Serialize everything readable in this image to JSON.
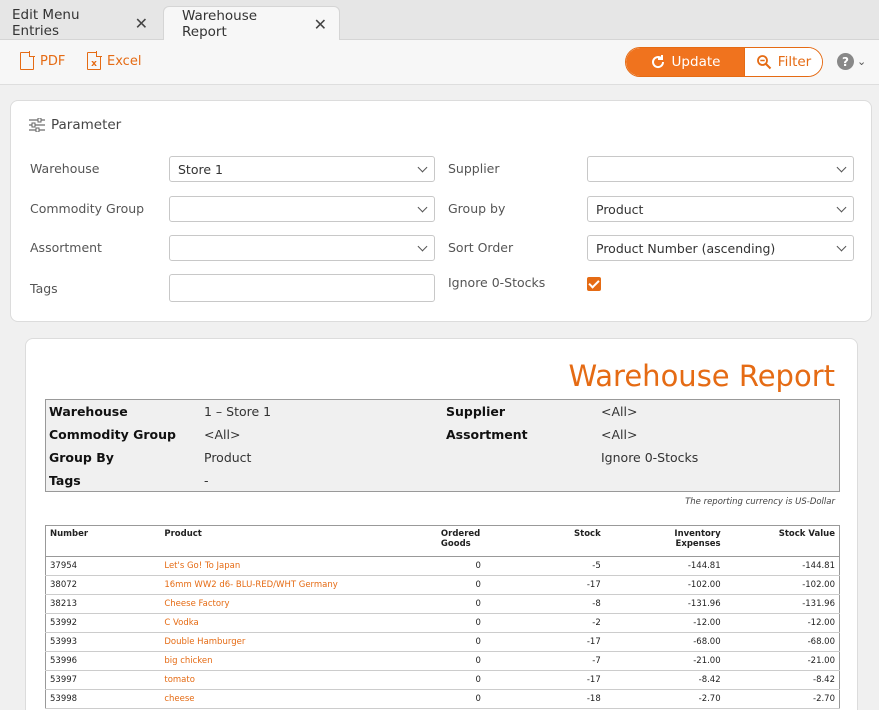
{
  "tabs": [
    {
      "label": "Edit Menu Entries",
      "active": false
    },
    {
      "label": "Warehouse Report",
      "active": true
    }
  ],
  "toolbar": {
    "pdf_label": "PDF",
    "excel_label": "Excel",
    "update_label": "Update",
    "filter_label": "Filter",
    "help_glyph": "?",
    "accent_color": "#e56b14"
  },
  "parameter": {
    "title": "Parameter",
    "fields": {
      "warehouse": {
        "label": "Warehouse",
        "value": "Store 1"
      },
      "supplier": {
        "label": "Supplier",
        "value": ""
      },
      "commodity_group": {
        "label": "Commodity Group",
        "value": ""
      },
      "group_by": {
        "label": "Group by",
        "value": "Product"
      },
      "assortment": {
        "label": "Assortment",
        "value": ""
      },
      "sort_order": {
        "label": "Sort Order",
        "value": "Product Number (ascending)"
      },
      "tags": {
        "label": "Tags",
        "value": ""
      },
      "ignore_zero": {
        "label": "Ignore 0-Stocks",
        "checked": true
      }
    }
  },
  "report": {
    "title": "Warehouse Report",
    "summary": {
      "warehouse_label": "Warehouse",
      "warehouse_value": "1 – Store 1",
      "supplier_label": "Supplier",
      "supplier_value": "<All>",
      "commodity_label": "Commodity Group",
      "commodity_value": "<All>",
      "assortment_label": "Assortment",
      "assortment_value": "<All>",
      "groupby_label": "Group By",
      "groupby_value": "Product",
      "ignore_value": "Ignore 0-Stocks",
      "tags_label": "Tags",
      "tags_value": "-"
    },
    "currency_note": "The reporting currency is US-Dollar",
    "columns": [
      "Number",
      "Product",
      "Ordered Goods",
      "Stock",
      "Inventory Expenses",
      "Stock Value"
    ],
    "rows": [
      {
        "number": "37954",
        "product": "Let's Go! To Japan",
        "ordered": "0",
        "stock": "-5",
        "expenses": "-144.81",
        "value": "-144.81"
      },
      {
        "number": "38072",
        "product": "16mm WW2 d6- BLU-RED/WHT Germany",
        "ordered": "0",
        "stock": "-17",
        "expenses": "-102.00",
        "value": "-102.00"
      },
      {
        "number": "38213",
        "product": "Cheese Factory",
        "ordered": "0",
        "stock": "-8",
        "expenses": "-131.96",
        "value": "-131.96"
      },
      {
        "number": "53992",
        "product": "C Vodka",
        "ordered": "0",
        "stock": "-2",
        "expenses": "-12.00",
        "value": "-12.00"
      },
      {
        "number": "53993",
        "product": "Double Hamburger",
        "ordered": "0",
        "stock": "-17",
        "expenses": "-68.00",
        "value": "-68.00"
      },
      {
        "number": "53996",
        "product": "big chicken",
        "ordered": "0",
        "stock": "-7",
        "expenses": "-21.00",
        "value": "-21.00"
      },
      {
        "number": "53997",
        "product": "tomato",
        "ordered": "0",
        "stock": "-17",
        "expenses": "-8.42",
        "value": "-8.42"
      },
      {
        "number": "53998",
        "product": "cheese",
        "ordered": "0",
        "stock": "-18",
        "expenses": "-2.70",
        "value": "-2.70"
      }
    ]
  }
}
